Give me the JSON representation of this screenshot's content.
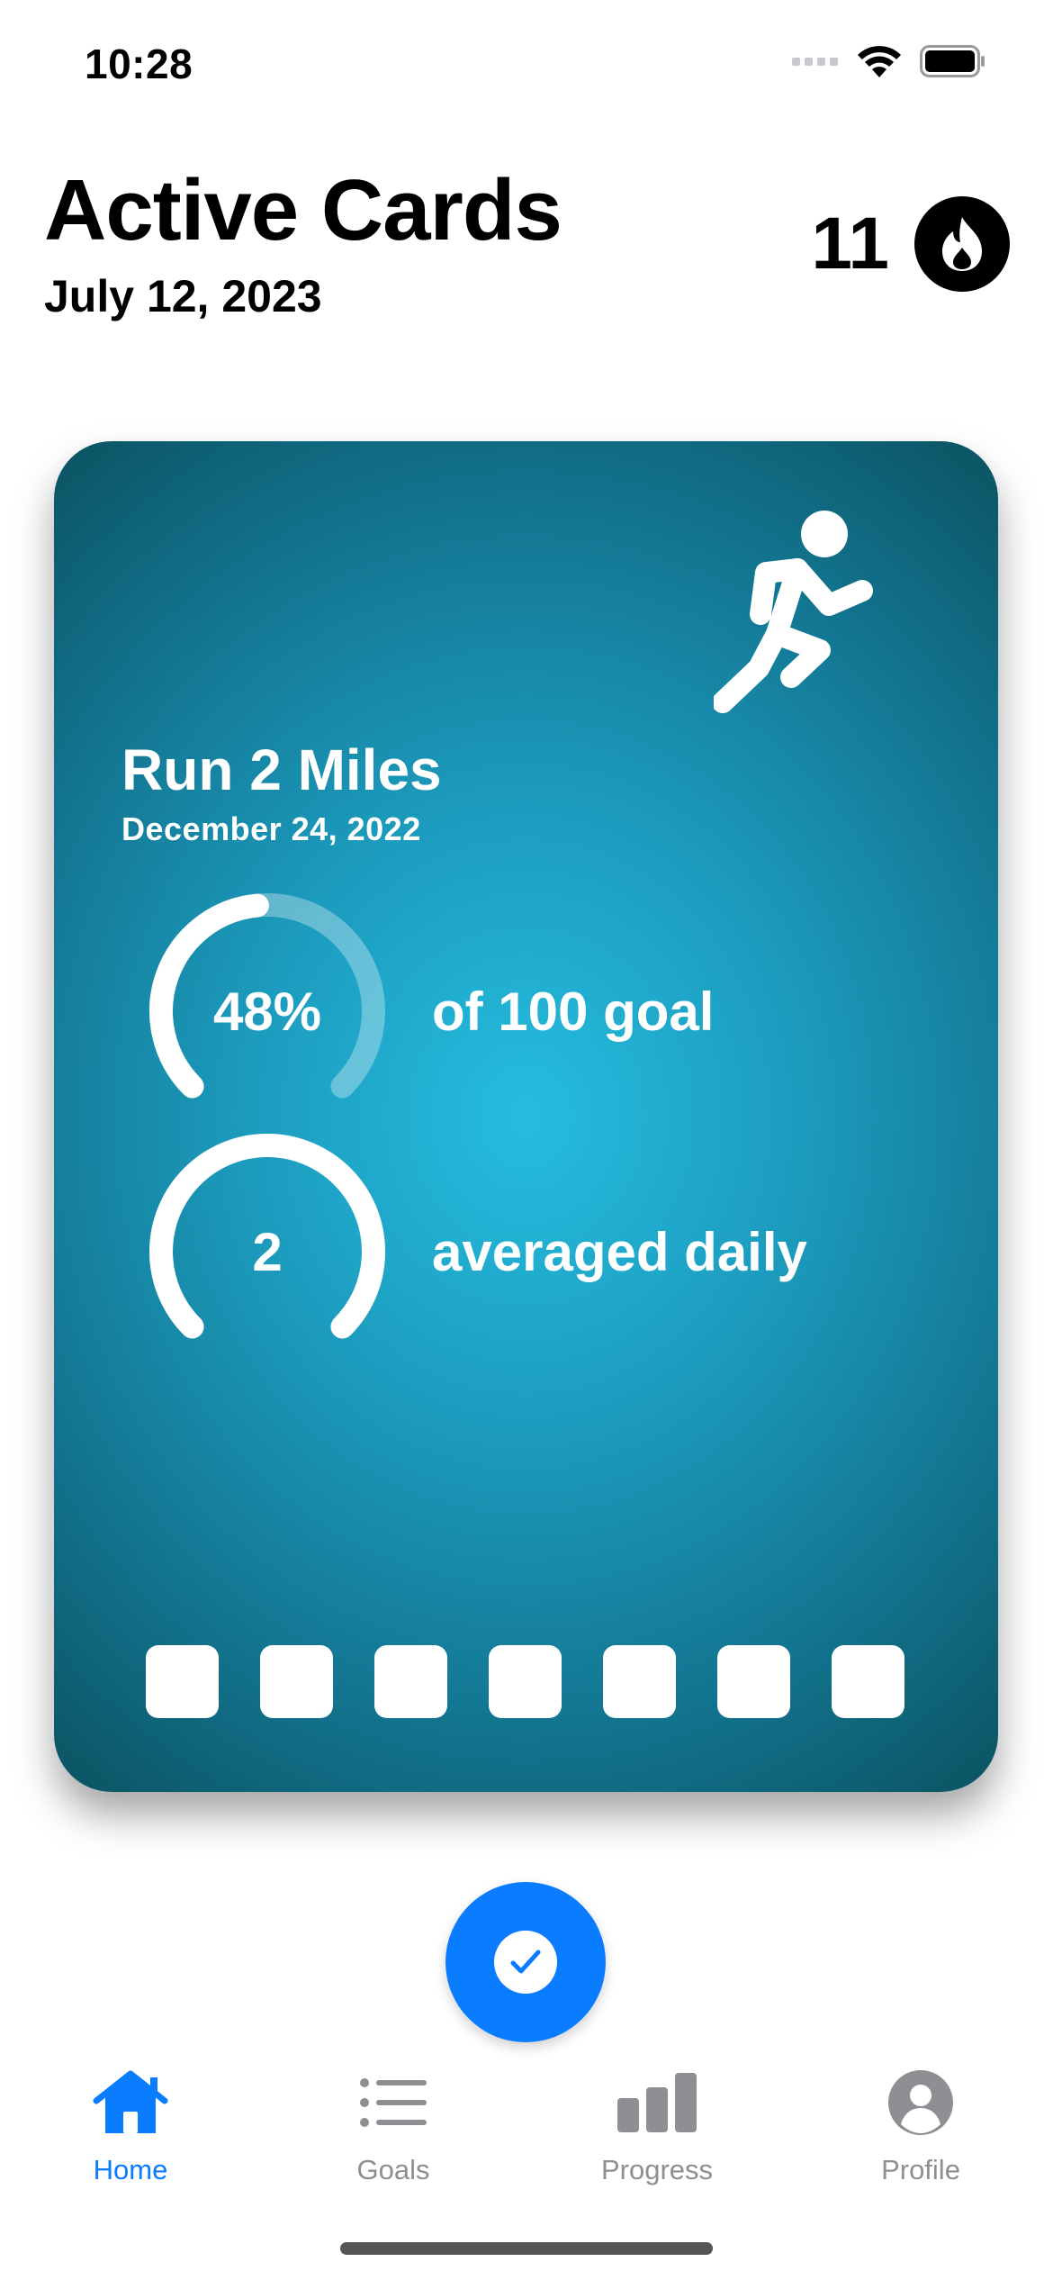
{
  "status_bar": {
    "time": "10:28"
  },
  "header": {
    "title": "Active Cards",
    "date": "July 12, 2023",
    "streak_count": "11"
  },
  "card": {
    "title": "Run 2 Miles",
    "date": "December 24, 2022",
    "icon": "figure-run-icon",
    "color": "#1c9bbd",
    "metrics": [
      {
        "value": "48%",
        "label": "of 100 goal",
        "progress": 0.48
      },
      {
        "value": "2",
        "label": "averaged daily",
        "progress": 1.0
      }
    ],
    "day_boxes": 7
  },
  "action_button": {
    "icon": "checkmark-icon",
    "color": "#0a7cff"
  },
  "tabs": [
    {
      "label": "Home",
      "icon": "house-icon",
      "active": true
    },
    {
      "label": "Goals",
      "icon": "list-icon",
      "active": false
    },
    {
      "label": "Progress",
      "icon": "chart-bar-icon",
      "active": false
    },
    {
      "label": "Profile",
      "icon": "person-icon",
      "active": false
    }
  ],
  "colors": {
    "accent": "#0a7cff",
    "inactive_tab": "#8e8e93"
  }
}
